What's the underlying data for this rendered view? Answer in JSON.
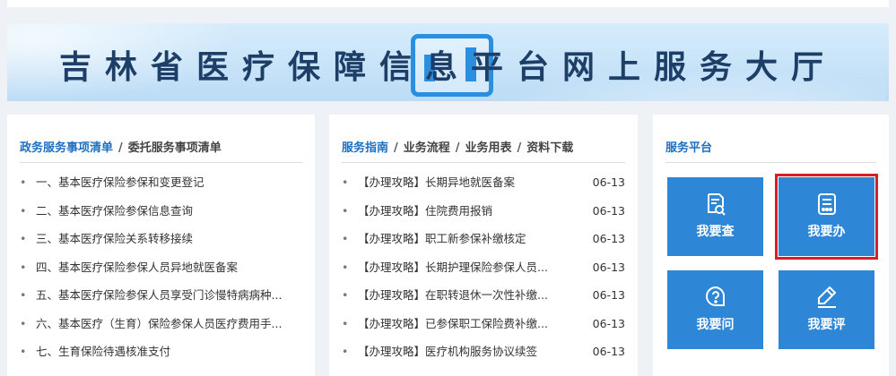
{
  "banner": {
    "title": "吉林省医疗保障信息平台网上服务大厅"
  },
  "policy_panel": {
    "tab_active": "政务服务事项清单",
    "separator": "/",
    "tab_other": "委托服务事项清单",
    "items": [
      "一、基本医疗保险参保和变更登记",
      "二、基本医疗保险参保信息查询",
      "三、基本医疗保险关系转移接续",
      "四、基本医疗保险参保人员异地就医备案",
      "五、基本医疗保险参保人员享受门诊慢特病病种...",
      "六、基本医疗（生育）保险参保人员医疗费用手...",
      "七、生育保险待遇核准支付"
    ]
  },
  "guide_panel": {
    "tab_active": "服务指南",
    "separator": "/",
    "tabs": [
      "业务流程",
      "业务用表",
      "资料下载"
    ],
    "items": [
      {
        "title": "【办理攻略】长期异地就医备案",
        "date": "06-13"
      },
      {
        "title": "【办理攻略】住院费用报销",
        "date": "06-13"
      },
      {
        "title": "【办理攻略】职工新参保补缴核定",
        "date": "06-13"
      },
      {
        "title": "【办理攻略】长期护理保险参保人员...",
        "date": "06-13"
      },
      {
        "title": "【办理攻略】在职转退休一次性补缴...",
        "date": "06-13"
      },
      {
        "title": "【办理攻略】已参保职工保险费补缴...",
        "date": "06-13"
      },
      {
        "title": "【办理攻略】医疗机构服务协议续签",
        "date": "06-13"
      }
    ]
  },
  "service_panel": {
    "title": "服务平台",
    "tiles": [
      {
        "label": "我要查",
        "icon": "search-document-icon"
      },
      {
        "label": "我要办",
        "icon": "form-list-icon"
      },
      {
        "label": "我要问",
        "icon": "question-chat-icon"
      },
      {
        "label": "我要评",
        "icon": "edit-review-icon"
      }
    ],
    "highlight_color": "#d91f26",
    "tile_color": "#2d86d6"
  }
}
